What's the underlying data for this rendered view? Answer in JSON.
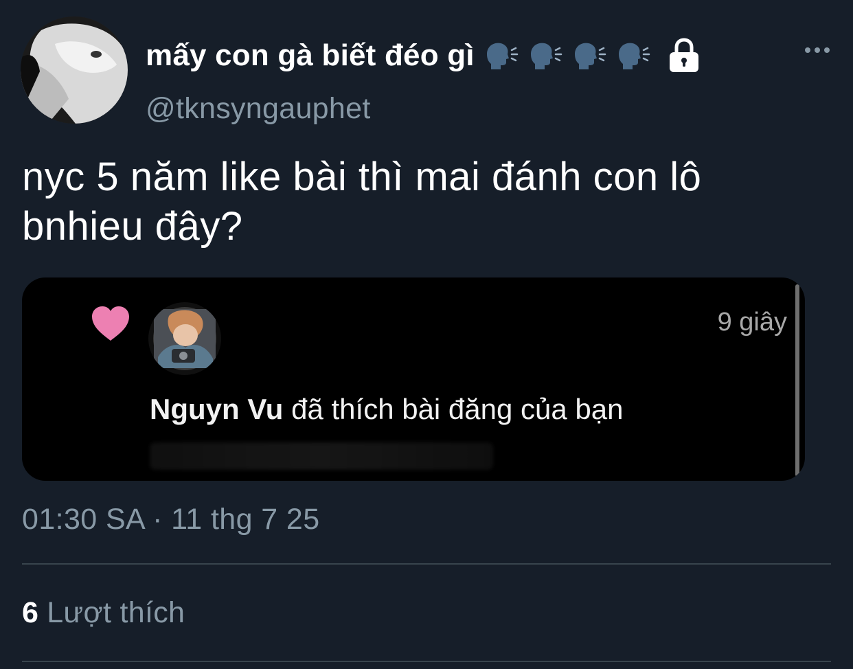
{
  "author": {
    "display_name": "mấy con gà biết đéo gì",
    "handle": "@tknsyngauphet",
    "badges": [
      "speaking-head-icon",
      "speaking-head-icon",
      "speaking-head-icon",
      "speaking-head-icon",
      "lock-icon"
    ]
  },
  "tweet": {
    "text": "nyc 5 năm like bài thì mai đánh con lô bnhieu đây?",
    "timestamp": "01:30 SA · 11 thg 7 25"
  },
  "embedded_screenshot": {
    "time_ago": "9 giây",
    "liker_name": "Nguyn Vu",
    "action_text": " đã thích bài đăng của bạn",
    "icon": "heart-icon"
  },
  "stats": {
    "likes_count": "6",
    "likes_label": "Lượt thích"
  },
  "colors": {
    "background": "#161e29",
    "secondary_text": "#8899a6",
    "heart": "#ed80b2"
  }
}
